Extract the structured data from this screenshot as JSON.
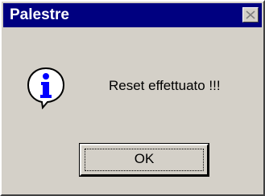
{
  "window": {
    "title": "Palestre",
    "close_icon": "close-icon"
  },
  "message": {
    "icon": "info-icon",
    "text": "Reset effettuato !!!"
  },
  "buttons": {
    "ok_label": "OK"
  },
  "colors": {
    "titlebar": "#000080",
    "face": "#d4d0c8",
    "title_text": "#ffffff",
    "info_blue": "#0000ff"
  }
}
